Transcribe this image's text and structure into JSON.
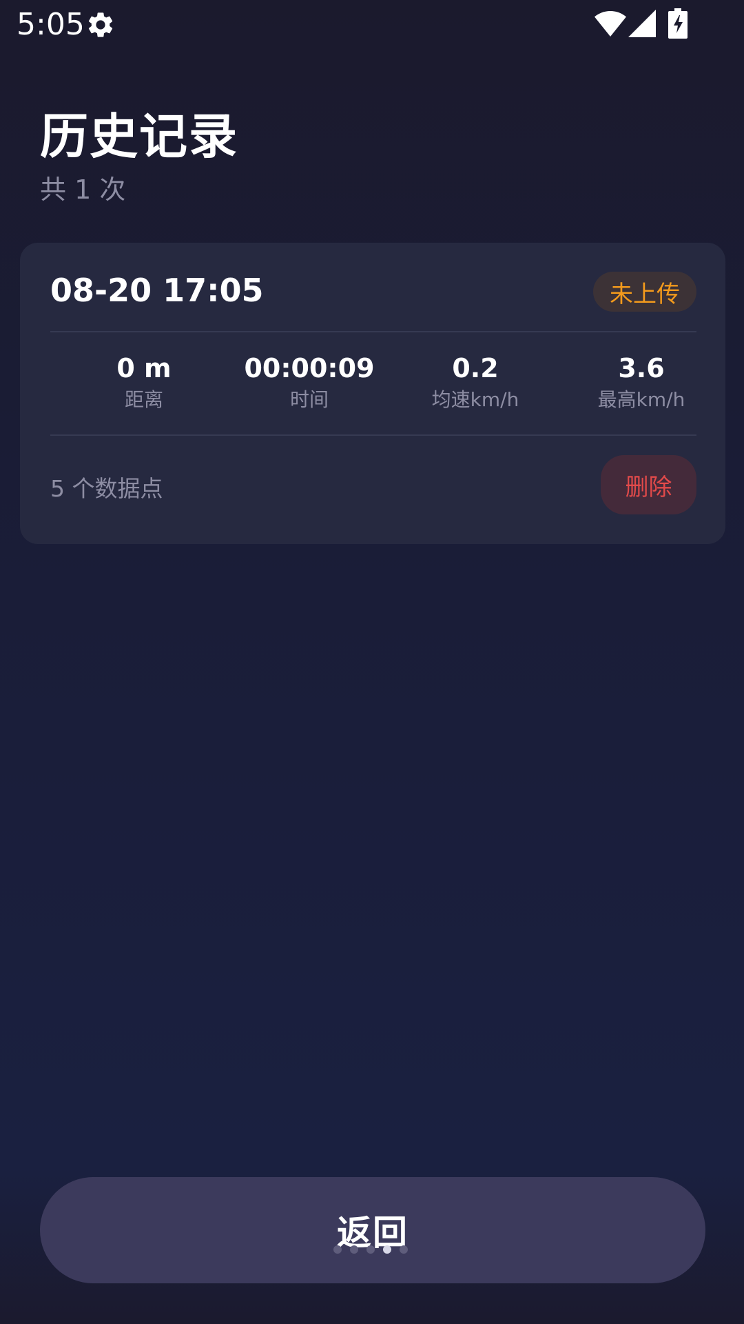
{
  "status_bar": {
    "time": "5:05",
    "icons": [
      "gear-icon",
      "wifi-icon",
      "signal-icon",
      "battery-charging-icon"
    ]
  },
  "header": {
    "title": "历史记录",
    "subtitle": "共 1 次"
  },
  "records": [
    {
      "datetime": "08-20 17:05",
      "upload_status": "未上传",
      "stats": [
        {
          "value": "0 m",
          "label": "距离"
        },
        {
          "value": "00:00:09",
          "label": "时间"
        },
        {
          "value": "0.2",
          "label": "均速km/h"
        },
        {
          "value": "3.6",
          "label": "最高km/h"
        }
      ],
      "data_points": "5 个数据点",
      "delete_label": "删除"
    }
  ],
  "footer": {
    "back_label": "返回",
    "page_indicator": {
      "count": 5,
      "active": 4
    }
  },
  "colors": {
    "background": "#1a1d38",
    "card": "#262940",
    "badge_text": "#f39a1c",
    "delete_text": "#e24a4a",
    "button": "#3c3a5c",
    "muted_text": "#8d8da3"
  }
}
